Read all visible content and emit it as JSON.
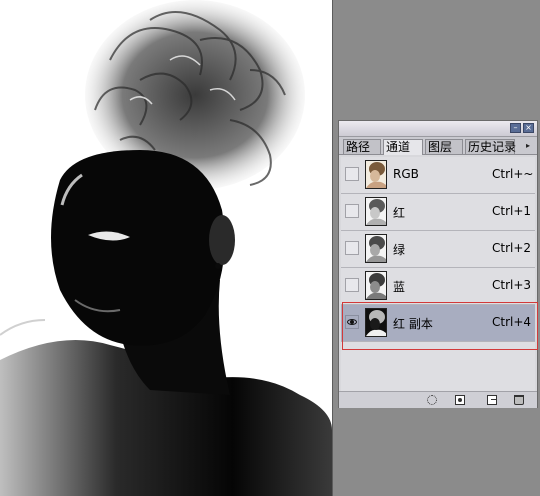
{
  "panel": {
    "tabs": [
      {
        "label": "路径"
      },
      {
        "label": "通道"
      },
      {
        "label": "图层"
      },
      {
        "label": "历史记录"
      }
    ],
    "menu_glyph": "▸",
    "min_glyph": "–",
    "close_glyph": "×"
  },
  "channels": [
    {
      "name": "RGB",
      "shortcut": "Ctrl+~",
      "visible": false,
      "selected": false
    },
    {
      "name": "红",
      "shortcut": "Ctrl+1",
      "visible": false,
      "selected": false
    },
    {
      "name": "绿",
      "shortcut": "Ctrl+2",
      "visible": false,
      "selected": false
    },
    {
      "name": "蓝",
      "shortcut": "Ctrl+3",
      "visible": false,
      "selected": false
    },
    {
      "name": "红 副本",
      "shortcut": "Ctrl+4",
      "visible": true,
      "selected": true
    }
  ],
  "footer_icons": [
    "load-selection-icon",
    "save-selection-icon",
    "new-channel-icon",
    "trash-icon"
  ],
  "colors": {
    "highlight_box": "#d23a3a",
    "selected_row": "#a8adc0"
  }
}
